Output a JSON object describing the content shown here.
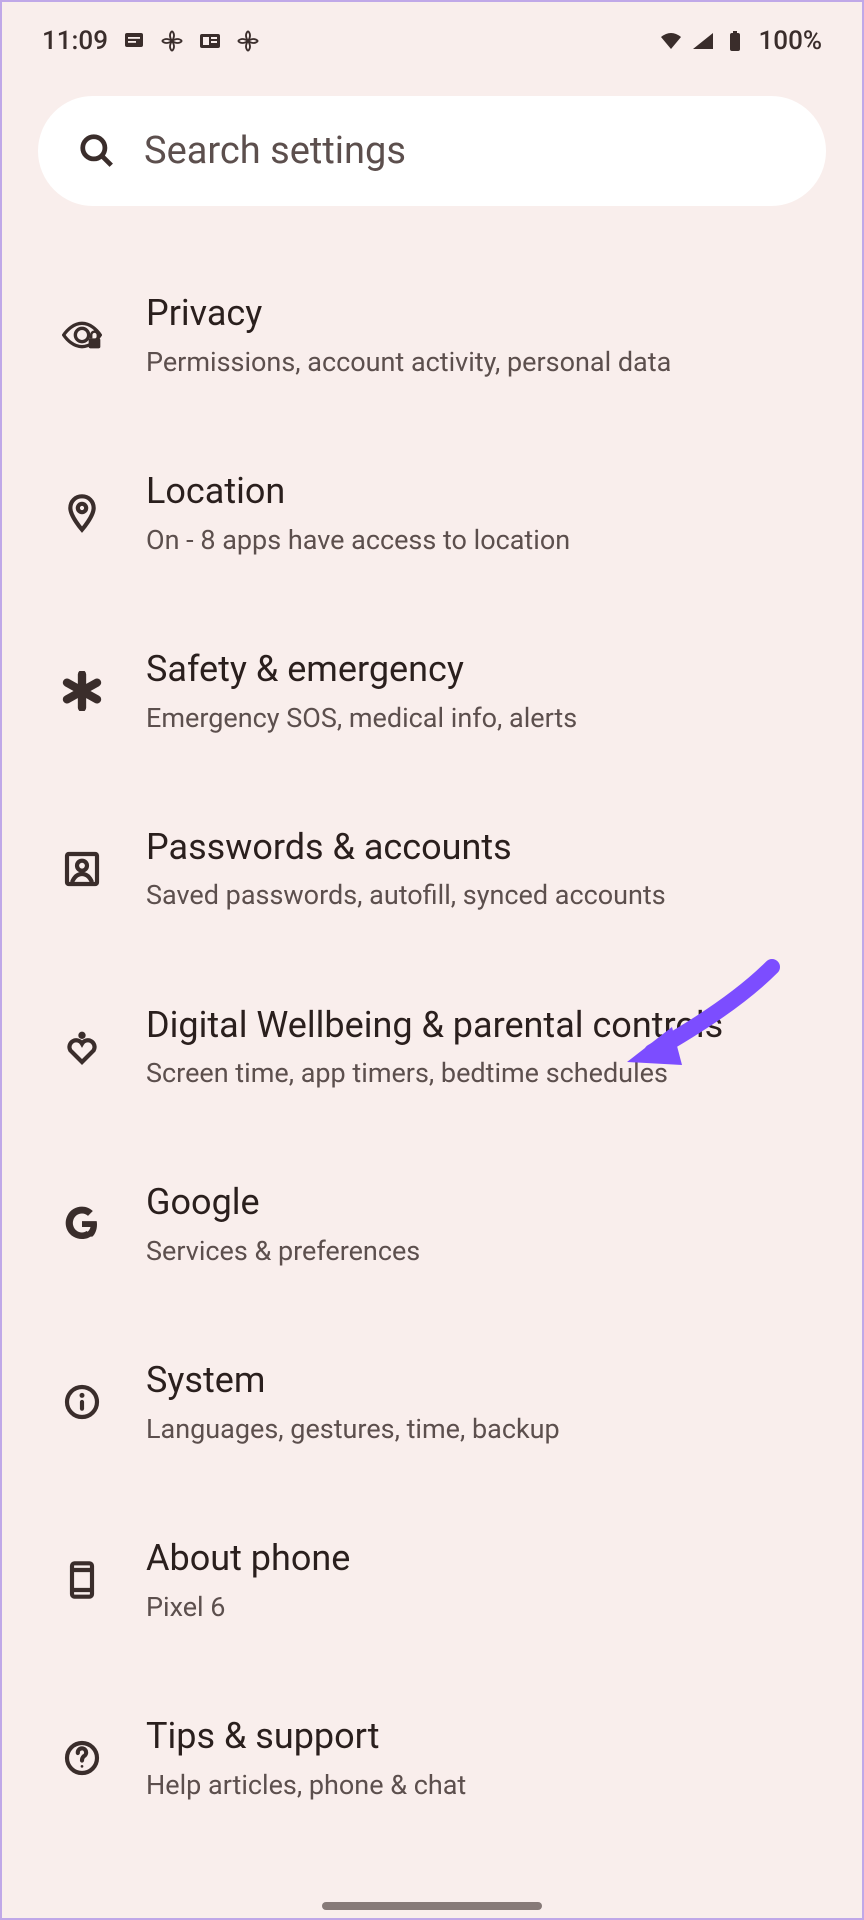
{
  "status": {
    "time": "11:09",
    "battery": "100%"
  },
  "search": {
    "placeholder": "Search settings"
  },
  "settings": [
    {
      "title": "Privacy",
      "subtitle": "Permissions, account activity, personal data"
    },
    {
      "title": "Location",
      "subtitle": "On - 8 apps have access to location"
    },
    {
      "title": "Safety & emergency",
      "subtitle": "Emergency SOS, medical info, alerts"
    },
    {
      "title": "Passwords & accounts",
      "subtitle": "Saved passwords, autofill, synced accounts"
    },
    {
      "title": "Digital Wellbeing & parental controls",
      "subtitle": "Screen time, app timers, bedtime schedules"
    },
    {
      "title": "Google",
      "subtitle": "Services & preferences"
    },
    {
      "title": "System",
      "subtitle": "Languages, gestures, time, backup"
    },
    {
      "title": "About phone",
      "subtitle": "Pixel 6"
    },
    {
      "title": "Tips & support",
      "subtitle": "Help articles, phone & chat"
    }
  ]
}
